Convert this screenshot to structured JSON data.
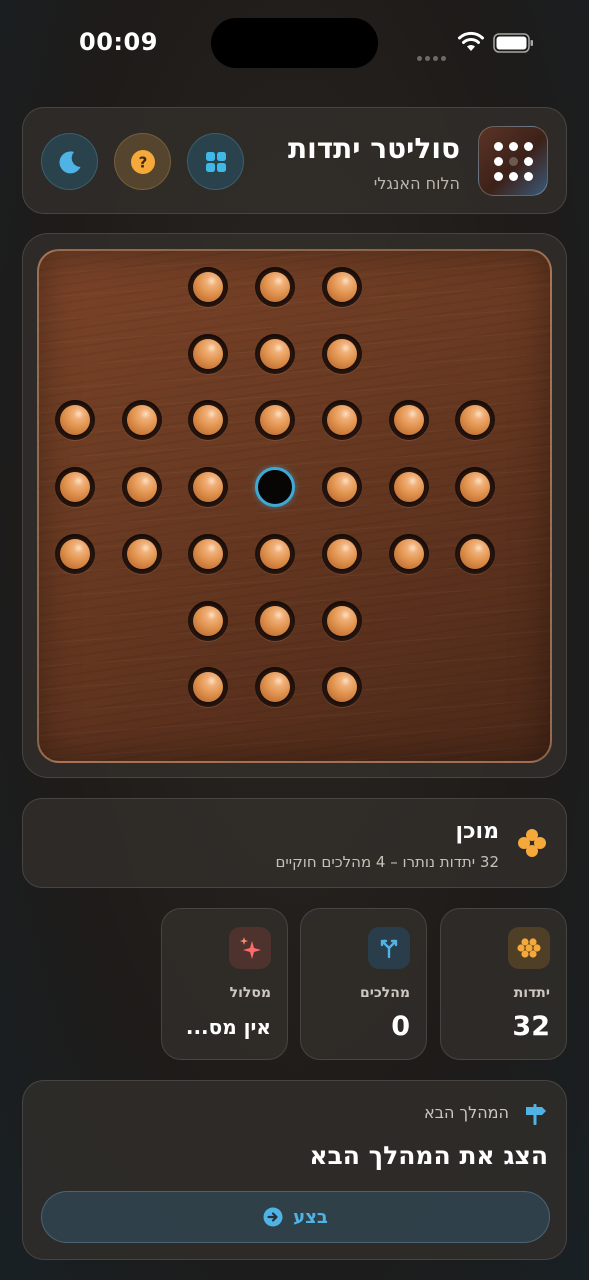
{
  "status_bar": {
    "time": "00:09"
  },
  "header": {
    "title": "סוליטר יתדות",
    "subtitle": "הלוח האנגלי",
    "buttons": [
      {
        "name": "grid-button",
        "icon": "grid-icon"
      },
      {
        "name": "help-button",
        "icon": "question-icon"
      },
      {
        "name": "theme-button",
        "icon": "moon-icon"
      }
    ]
  },
  "board": {
    "layout": "english",
    "rows": [
      "  xxx  ",
      "  xxx  ",
      "xxxxxxx",
      "xxxoxxx",
      "xxxxxxx",
      "  xxx  ",
      "  xxx  "
    ],
    "selected_color": "#3fa9d6"
  },
  "status": {
    "title": "מוכן",
    "detail": "32 יתדות נותרו – 4 מהלכים חוקיים"
  },
  "stats": {
    "pegs": {
      "label": "יתדות",
      "value": "32"
    },
    "moves": {
      "label": "מהלכים",
      "value": "0"
    },
    "path": {
      "label": "מסלול",
      "value": "אין מס..."
    }
  },
  "next_move": {
    "label": "המהלך הבא",
    "title": "הצג את המהלך הבא",
    "button_label": "בצע"
  },
  "colors": {
    "accent_blue": "#4fb3e6",
    "accent_orange": "#f5a93a",
    "accent_pink": "#ff6b6b",
    "peg": "#e29550"
  }
}
